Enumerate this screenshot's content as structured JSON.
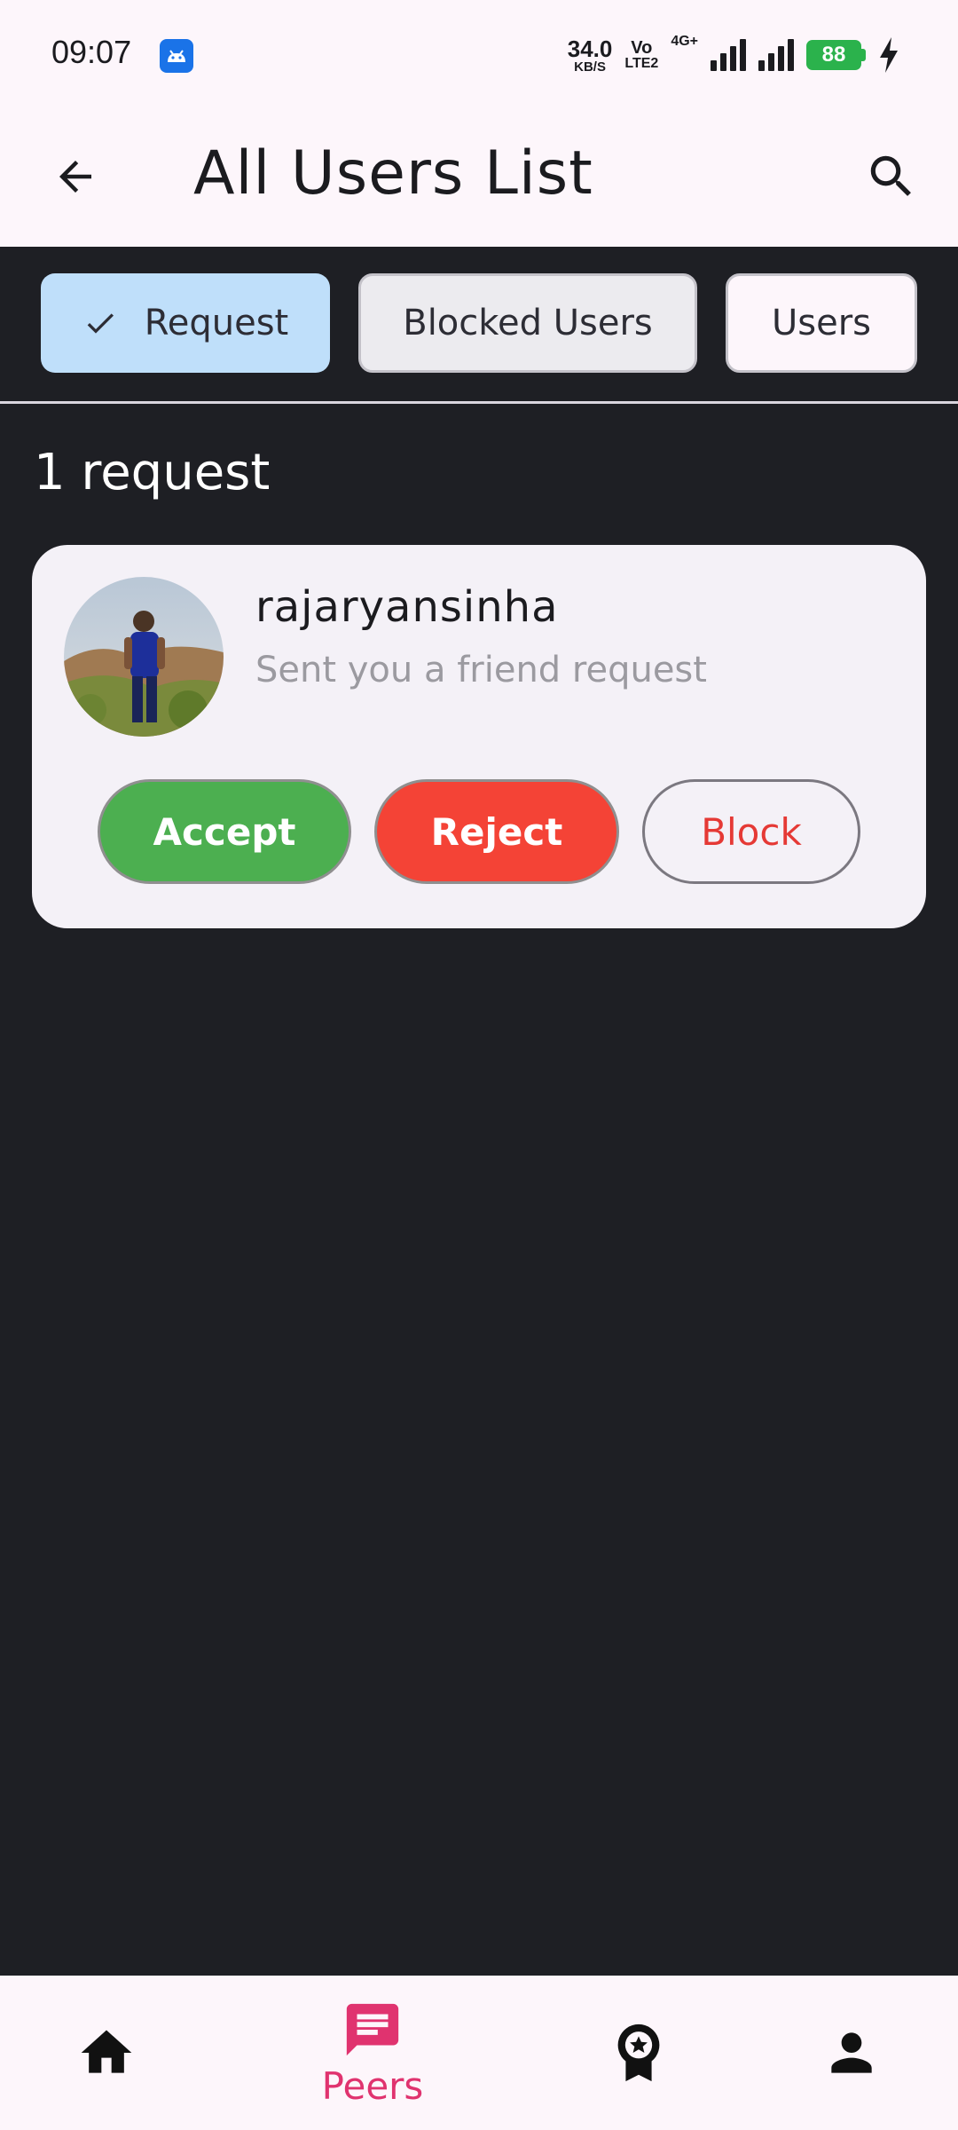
{
  "status_bar": {
    "time": "09:07",
    "net_speed_value": "34.0",
    "net_speed_unit": "KB/S",
    "volte_top": "Vo",
    "volte_bottom": "LTE2",
    "network_type": "4G+",
    "battery_level": "88"
  },
  "app_bar": {
    "title": "All Users List"
  },
  "chips": {
    "request": "Request",
    "blocked": "Blocked Users",
    "users": "Users"
  },
  "request_count": "1 request",
  "request_card": {
    "username": "rajaryansinha",
    "subtitle": "Sent you a friend request",
    "accept_label": "Accept",
    "reject_label": "Reject",
    "block_label": "Block"
  },
  "bottom_nav": {
    "active_label": "Peers",
    "items": [
      "home-icon",
      "chat-icon",
      "award-icon",
      "person-icon"
    ]
  },
  "colors": {
    "accent": "#e0336f",
    "accept": "#4caf50",
    "reject": "#f44336",
    "block_text": "#e53935",
    "selected_chip": "#bfdffa",
    "background": "#1e1f24"
  }
}
